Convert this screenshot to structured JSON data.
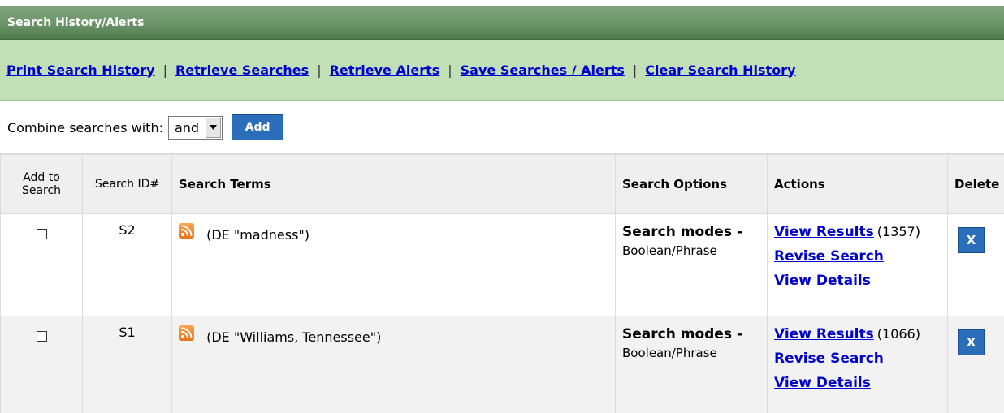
{
  "panel": {
    "title": "Search History/Alerts"
  },
  "links": [
    "Print Search History",
    "Retrieve Searches",
    "Retrieve Alerts",
    "Save Searches / Alerts",
    "Clear Search History"
  ],
  "link_separator": "|",
  "combine": {
    "label": "Combine searches with:",
    "selected": "and",
    "add_label": "Add"
  },
  "columns": {
    "add": "Add to Search",
    "id": "Search ID#",
    "terms": "Search Terms",
    "options": "Search Options",
    "actions": "Actions",
    "delete": "Delete"
  },
  "rows": [
    {
      "id": "S2",
      "terms": "(DE \"madness\")",
      "mode_label": "Search modes -",
      "mode_value": "Boolean/Phrase",
      "view_results": "View Results",
      "count": "(1357)",
      "revise": "Revise Search",
      "details": "View Details",
      "delete_label": "X"
    },
    {
      "id": "S1",
      "terms": "(DE \"Williams, Tennessee\")",
      "mode_label": "Search modes -",
      "mode_value": "Boolean/Phrase",
      "view_results": "View Results",
      "count": "(1066)",
      "revise": "Revise Search",
      "details": "View Details",
      "delete_label": "X"
    }
  ],
  "colors": {
    "title_bar": "#6b9468",
    "links_bar": "#c2e0b6",
    "link": "#0000cc",
    "button": "#2a6db8"
  },
  "icons": {
    "feed": "rss-feed-icon",
    "dropdown": "chevron-down-icon"
  }
}
